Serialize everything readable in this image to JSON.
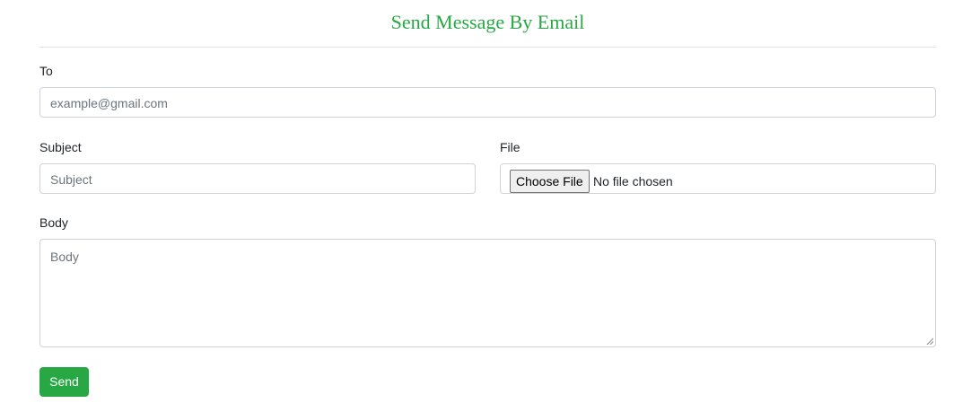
{
  "header": {
    "title": "Send Message By Email"
  },
  "form": {
    "to": {
      "label": "To",
      "placeholder": "example@gmail.com",
      "value": ""
    },
    "subject": {
      "label": "Subject",
      "placeholder": "Subject",
      "value": ""
    },
    "file": {
      "label": "File",
      "button_label": "Choose File",
      "status": "No file chosen"
    },
    "body": {
      "label": "Body",
      "placeholder": "Body",
      "value": ""
    },
    "send_label": "Send"
  },
  "colors": {
    "accent": "#28a745",
    "border": "#ced4da",
    "placeholder": "#6c757d",
    "text": "#212529"
  }
}
